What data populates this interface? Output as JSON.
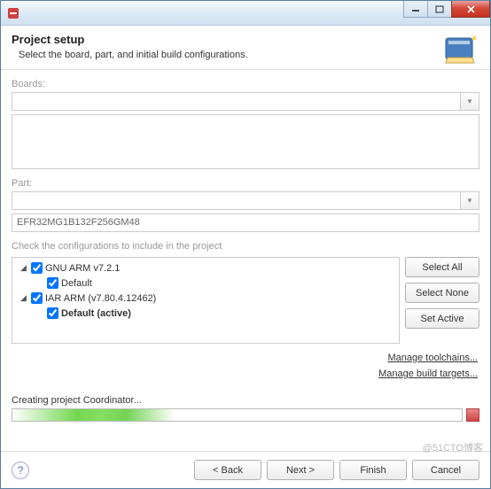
{
  "header": {
    "title": "Project setup",
    "subtitle": "Select the board, part, and initial build configurations."
  },
  "boards": {
    "label": "Boards:"
  },
  "part": {
    "label": "Part:",
    "value": "EFR32MG1B132F256GM48"
  },
  "config": {
    "hint": "Check the configurations to include in the project",
    "tree": [
      {
        "level": 0,
        "expanded": true,
        "checked": true,
        "label": "GNU ARM v7.2.1",
        "bold": false
      },
      {
        "level": 1,
        "expanded": null,
        "checked": true,
        "label": "Default",
        "bold": false
      },
      {
        "level": 0,
        "expanded": true,
        "checked": true,
        "label": "IAR ARM (v7.80.4.12462)",
        "bold": false
      },
      {
        "level": 1,
        "expanded": null,
        "checked": true,
        "label": "Default (active)",
        "bold": true
      }
    ],
    "buttons": {
      "select_all": "Select All",
      "select_none": "Select None",
      "set_active": "Set Active"
    }
  },
  "links": {
    "toolchains": "Manage toolchains...",
    "targets": "Manage build targets..."
  },
  "progress": {
    "label": "Creating project Coordinator..."
  },
  "footer": {
    "back": "< Back",
    "next": "Next >",
    "finish": "Finish",
    "cancel": "Cancel"
  },
  "watermark": "@51CTO博客"
}
